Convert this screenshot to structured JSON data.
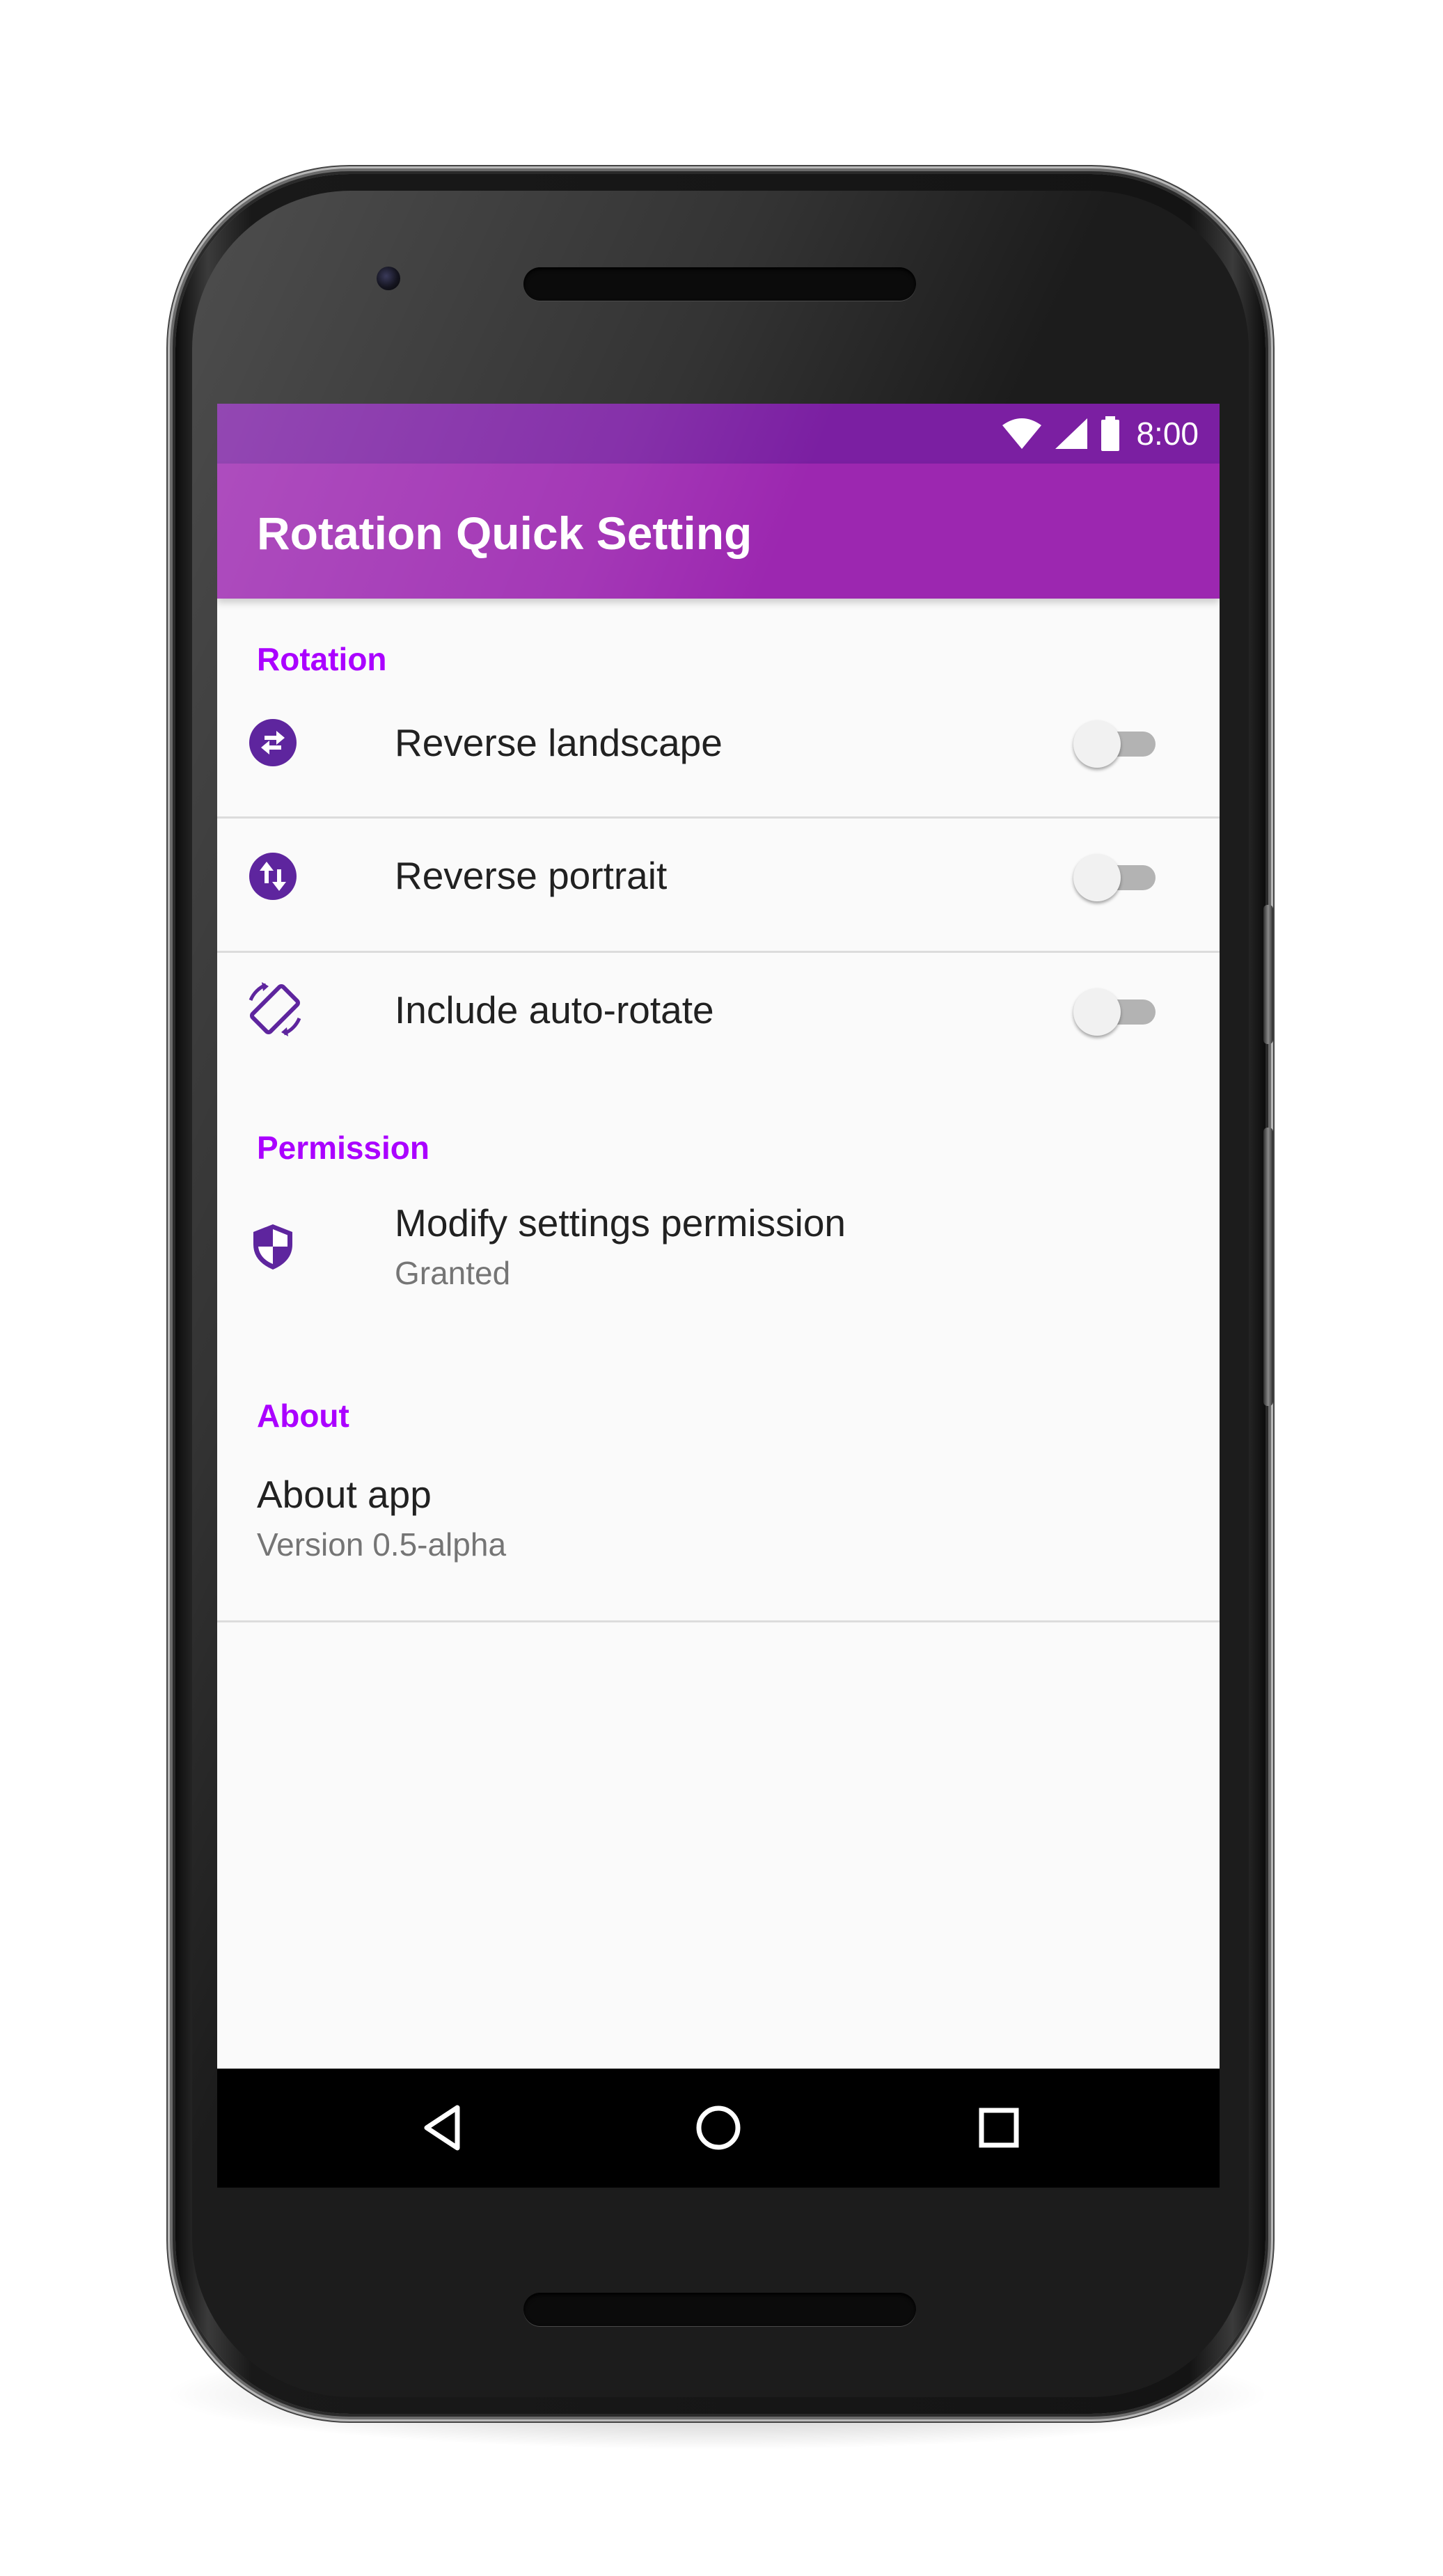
{
  "status_bar": {
    "time": "8:00"
  },
  "app_bar": {
    "title": "Rotation Quick Setting"
  },
  "sections": {
    "rotation": {
      "header": "Rotation",
      "items": [
        {
          "label": "Reverse landscape",
          "icon": "swap-horizontal-circle-icon",
          "enabled": false
        },
        {
          "label": "Reverse portrait",
          "icon": "swap-vertical-circle-icon",
          "enabled": false
        },
        {
          "label": "Include auto-rotate",
          "icon": "screen-rotation-icon",
          "enabled": false
        }
      ]
    },
    "permission": {
      "header": "Permission",
      "item": {
        "label": "Modify settings permission",
        "summary": "Granted",
        "icon": "security-shield-icon"
      }
    },
    "about": {
      "header": "About",
      "item": {
        "label": "About app",
        "summary": "Version 0.5-alpha"
      }
    }
  },
  "nav_bar": {
    "back": "back-icon",
    "home": "home-icon",
    "recents": "recents-icon"
  },
  "colors": {
    "primary": "#9c27b0",
    "primary_dark": "#7b1fa2",
    "accent": "#aa00ff",
    "icon": "#5e259e"
  }
}
